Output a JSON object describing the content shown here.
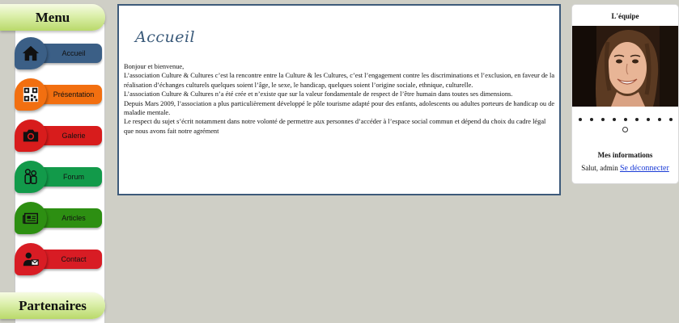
{
  "sidebar": {
    "menu_title": "Menu",
    "partners_title": "Partenaires",
    "items": [
      {
        "label": "Accueil",
        "color": "#3b5f86",
        "icon": "home-icon"
      },
      {
        "label": "Présentation",
        "color": "#f26f10",
        "icon": "qr-code-icon"
      },
      {
        "label": "Galerie",
        "color": "#d81c1c",
        "icon": "camera-icon"
      },
      {
        "label": "Forum",
        "color": "#129a4a",
        "icon": "people-icon"
      },
      {
        "label": "Articles",
        "color": "#2d8f12",
        "icon": "newspaper-icon"
      },
      {
        "label": "Contact",
        "color": "#d81c24",
        "icon": "contact-icon"
      }
    ]
  },
  "main": {
    "title": "Accueil",
    "paragraphs": [
      "Bonjour et bienvenue,",
      "L’association Culture & Cultures c’est la rencontre entre la Culture &  les Cultures, c’est l’engagement contre les discriminations et l’exclusion, en faveur de la réalisation d’échanges culturels quelques soient l’âge, le sexe, le handicap, quelques soient l’origine sociale, ethnique, culturelle.",
      "L’association Culture & Cultures n’a été crée et n’existe que sur la valeur fondamentale de respect de l’être humain dans toutes ses dimensions.",
      "Depuis Mars 2009, l’association a plus particulièrement développé le pôle tourisme adapté pour des enfants, adolescents ou adultes porteurs de handicap ou de maladie mentale.",
      "Le respect du sujet s’écrit notamment dans notre volonté de permettre aux personnes d’accéder à l’espace social commun et dépend du choix du cadre légal que  nous avons fait notre agrément"
    ]
  },
  "right": {
    "team_title": "L'équipe",
    "slides_total": 10,
    "slide_active_index": 9,
    "info_title": "Mes informations",
    "greeting_prefix": "Salut, admin",
    "logout_label": "Se déconnecter"
  },
  "colors": {
    "background": "#cfcfc6",
    "content_border": "#3d5a7a",
    "title_color": "#3a5a7a",
    "menu_gradient_end": "#b9d96a"
  }
}
